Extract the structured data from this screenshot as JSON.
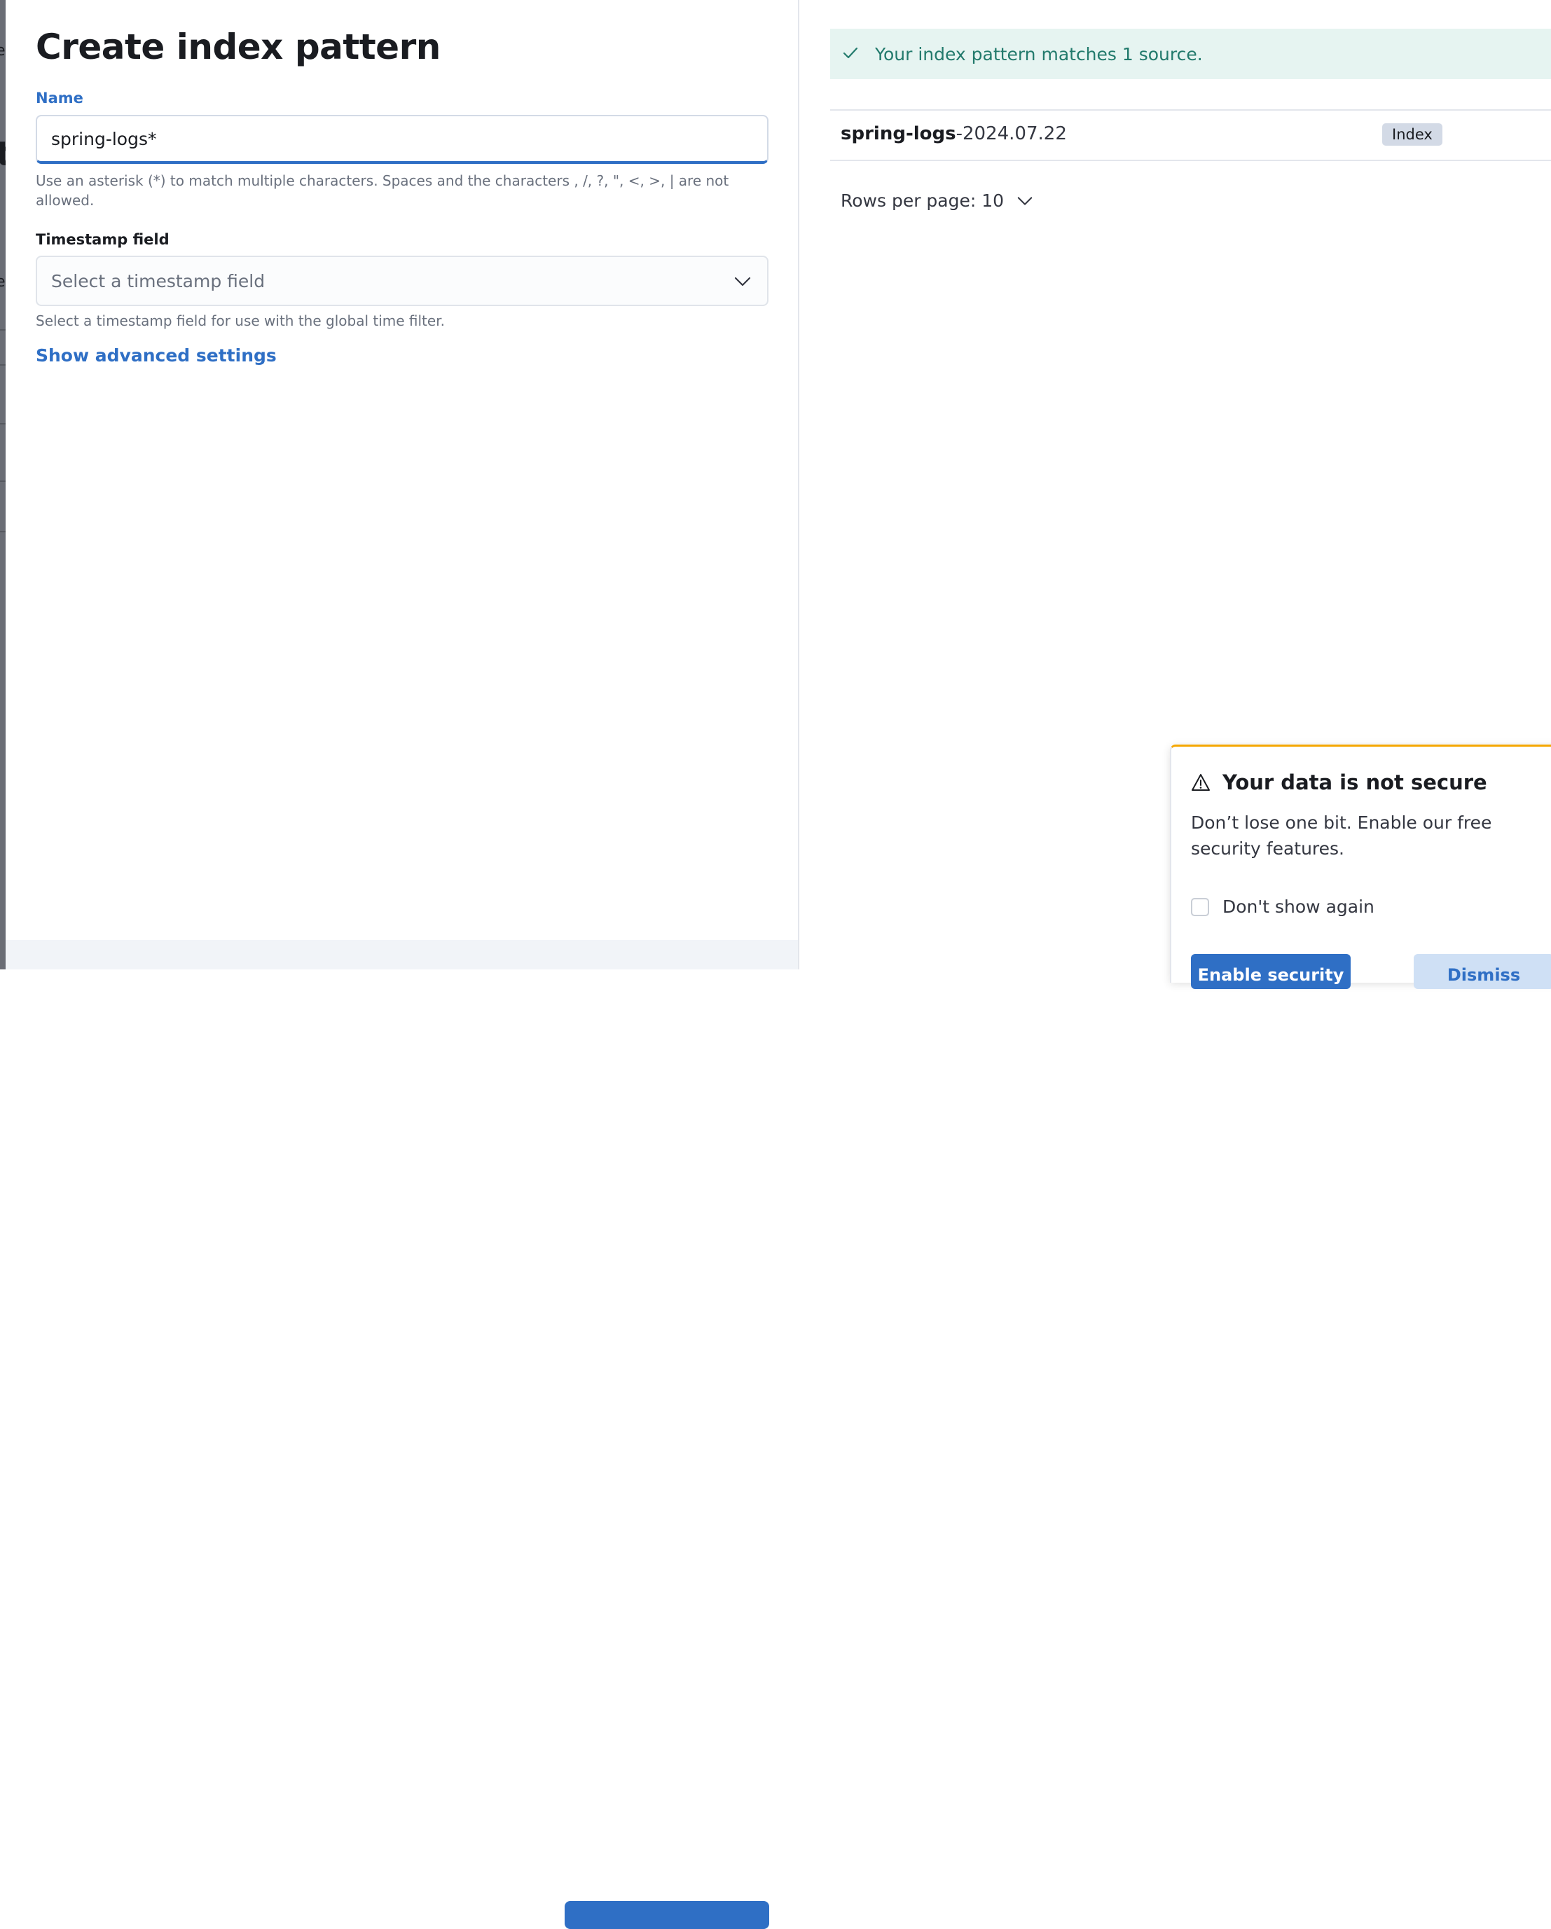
{
  "form": {
    "title": "Create index pattern",
    "name_label": "Name",
    "name_value": "spring-logs*",
    "name_help": "Use an asterisk (*) to match multiple characters. Spaces and the characters , /, ?, \", <, >, | are not allowed.",
    "timestamp_label": "Timestamp field",
    "timestamp_placeholder": "Select a timestamp field",
    "timestamp_help": "Select a timestamp field for use with the global time filter.",
    "advanced_link": "Show advanced settings"
  },
  "results": {
    "match_message": "Your index pattern matches 1 source.",
    "sources": [
      {
        "name_match": "spring-logs",
        "name_rest": "-2024.07.22",
        "type": "Index"
      }
    ],
    "rows_per_page": "Rows per page: 10"
  },
  "toast": {
    "title": "Your data is not secure",
    "body": "Don’t lose one bit. Enable our free security features.",
    "checkbox_label": "Don't show again",
    "enable_button": "Enable security",
    "dismiss_button": "Dismiss"
  },
  "icons": {
    "check": "check-icon",
    "chevron": "chevron-down-icon",
    "warning": "warning-icon"
  },
  "colors": {
    "accent": "#2f6fc5",
    "success_bg": "#e6f4f1",
    "success_text": "#227a6c",
    "warning_border": "#f5a700"
  }
}
